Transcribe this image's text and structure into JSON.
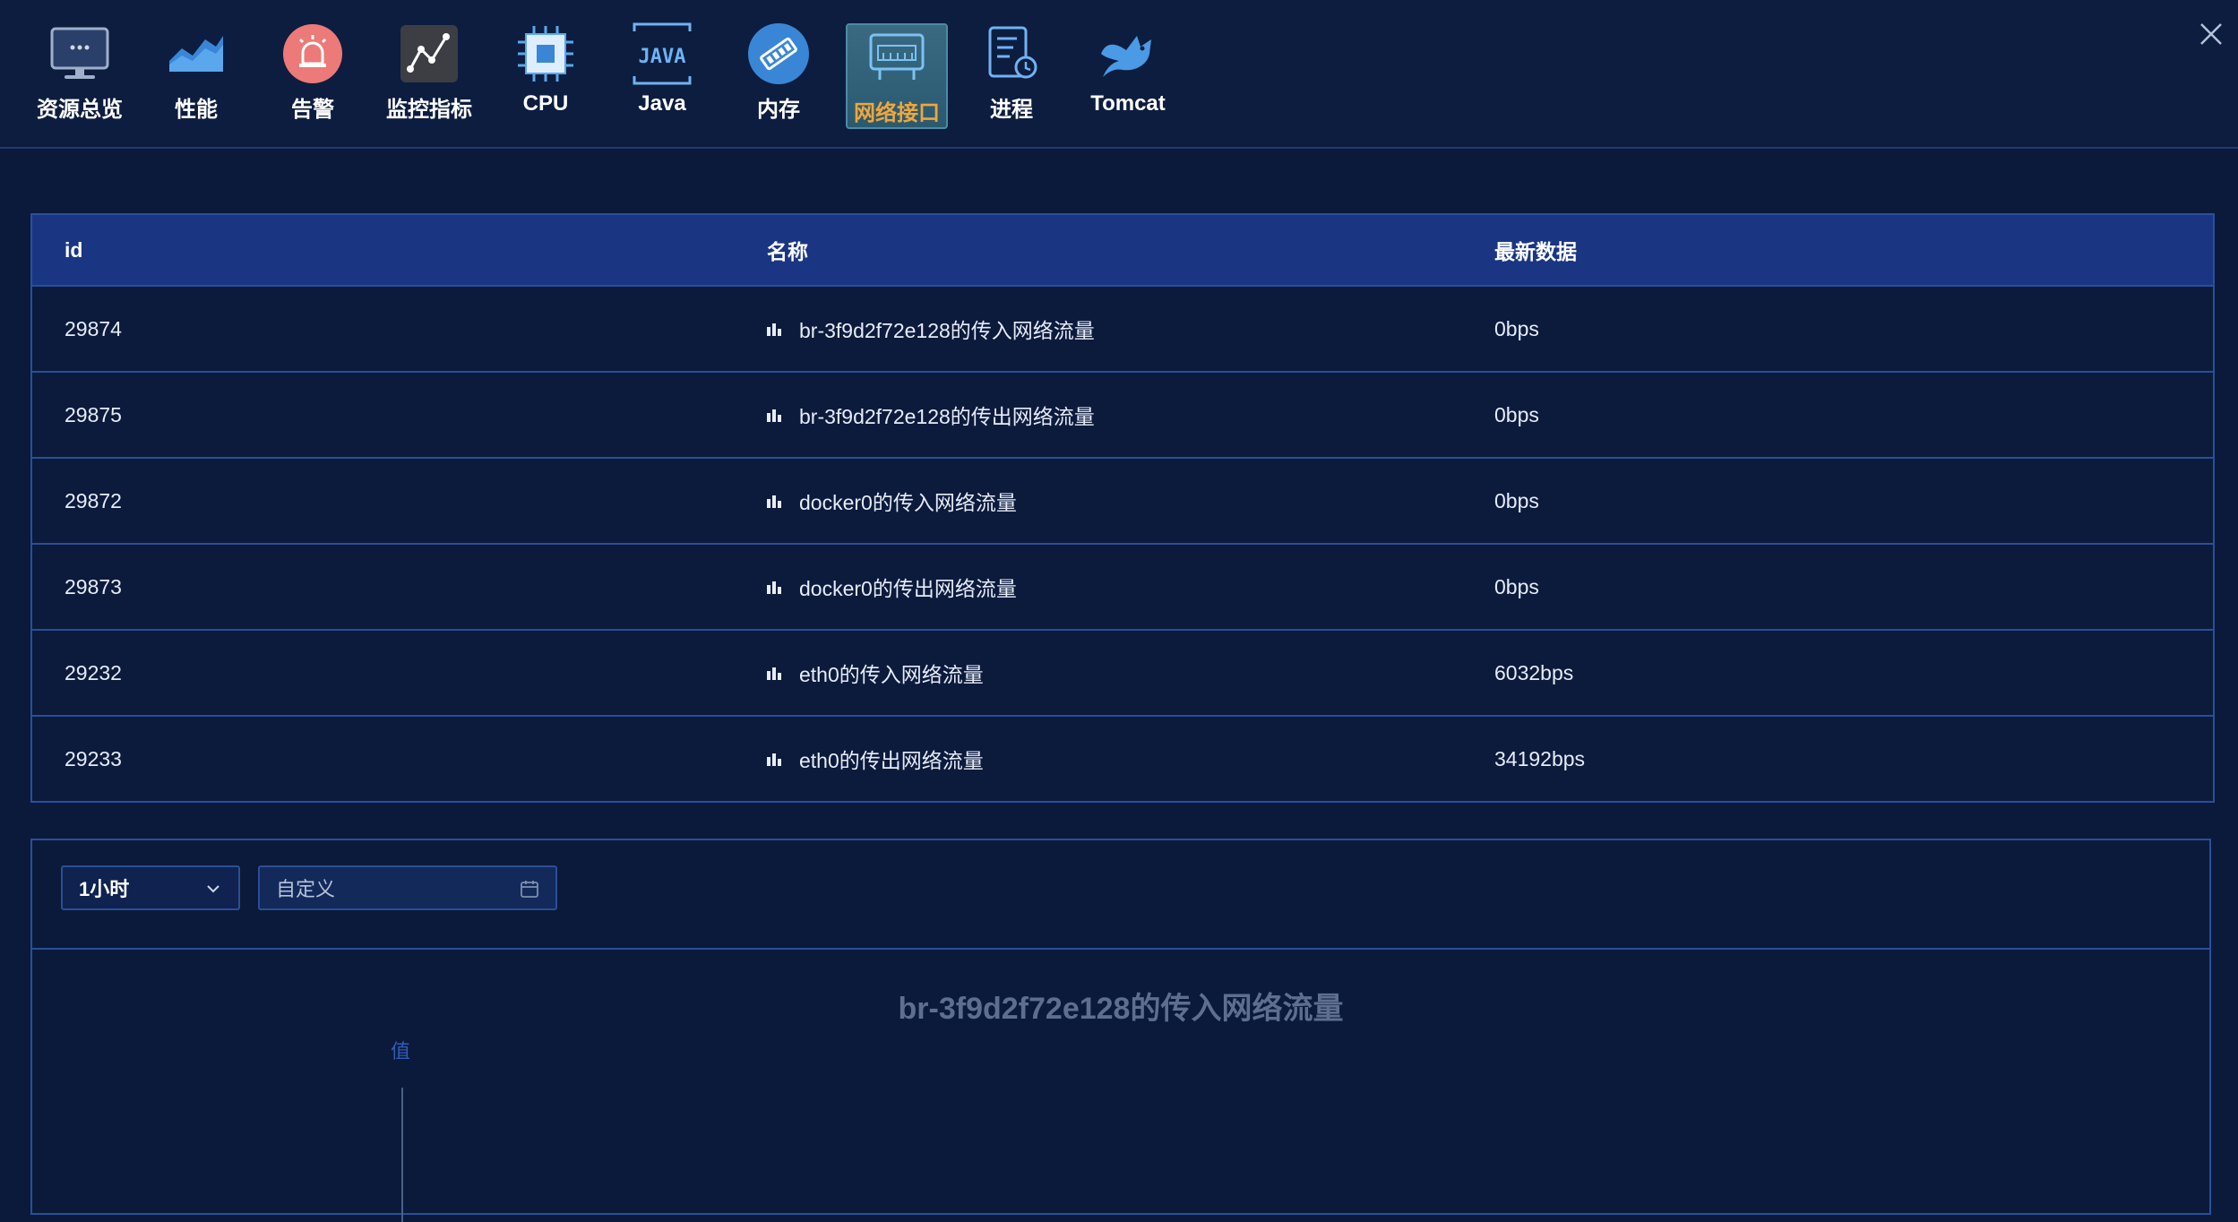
{
  "toolbar": {
    "items": [
      {
        "label": "资源总览",
        "icon": "monitor-icon"
      },
      {
        "label": "性能",
        "icon": "area-chart-icon"
      },
      {
        "label": "告警",
        "icon": "alarm-icon"
      },
      {
        "label": "监控指标",
        "icon": "line-chart-icon"
      },
      {
        "label": "CPU",
        "icon": "cpu-icon"
      },
      {
        "label": "Java",
        "icon": "java-icon"
      },
      {
        "label": "内存",
        "icon": "memory-icon"
      },
      {
        "label": "网络接口",
        "icon": "network-icon",
        "active": true
      },
      {
        "label": "进程",
        "icon": "process-icon"
      },
      {
        "label": "Tomcat",
        "icon": "tomcat-icon"
      }
    ]
  },
  "table": {
    "headers": {
      "id": "id",
      "name": "名称",
      "latest": "最新数据"
    },
    "rows": [
      {
        "id": "29874",
        "name": "br-3f9d2f72e128的传入网络流量",
        "latest": "0bps"
      },
      {
        "id": "29875",
        "name": "br-3f9d2f72e128的传出网络流量",
        "latest": "0bps"
      },
      {
        "id": "29872",
        "name": "docker0的传入网络流量",
        "latest": "0bps"
      },
      {
        "id": "29873",
        "name": "docker0的传出网络流量",
        "latest": "0bps"
      },
      {
        "id": "29232",
        "name": "eth0的传入网络流量",
        "latest": "6032bps"
      },
      {
        "id": "29233",
        "name": "eth0的传出网络流量",
        "latest": "34192bps"
      }
    ]
  },
  "filters": {
    "range_value": "1小时",
    "date_placeholder": "自定义"
  },
  "chart": {
    "title": "br-3f9d2f72e128的传入网络流量",
    "ylabel": "值"
  },
  "colors": {
    "background": "#0b1a3a",
    "header": "#1a3683",
    "border": "#2a4f9a",
    "active_label": "#f0a63a"
  }
}
